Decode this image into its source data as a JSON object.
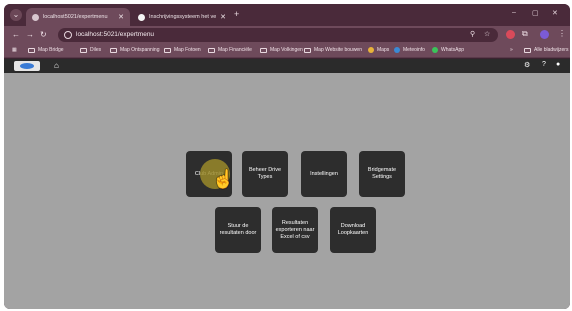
{
  "browser": {
    "tabs": [
      {
        "title": "localhost5021/expertmenu",
        "active": true
      },
      {
        "title": "Inschrijvingssysteem het verplaats",
        "active": false
      }
    ],
    "new_tab": "+",
    "window_controls": {
      "minimize": "–",
      "maximize": "▢",
      "close": "✕"
    },
    "url": "localhost:5021/expertmenu",
    "bookmarks": [
      {
        "label": "Map Bridge",
        "icon": "folder-icon"
      },
      {
        "label": "Diles",
        "icon": "folder-icon"
      },
      {
        "label": "Map Ontspanning",
        "icon": "folder-icon"
      },
      {
        "label": "Map Fotoen",
        "icon": "folder-icon"
      },
      {
        "label": "Map Financiële",
        "icon": "folder-icon"
      },
      {
        "label": "Map Volkingen",
        "icon": "folder-icon"
      },
      {
        "label": "Map Website bouwen",
        "icon": "folder-icon"
      },
      {
        "label": "Maps",
        "icon": "maps-icon"
      },
      {
        "label": "Meteoinfo",
        "icon": "weather-icon"
      },
      {
        "label": "WhatsApp",
        "icon": "whatsapp-icon"
      },
      {
        "label": "Alle bladwijzers",
        "icon": "folder-icon"
      }
    ]
  },
  "app": {
    "help": "?"
  },
  "tiles": [
    {
      "label": "Club Admin"
    },
    {
      "label": "Beheer Drive Types"
    },
    {
      "label": "Instellingen"
    },
    {
      "label": "Bridgemate Settings"
    },
    {
      "label": "Stuur de resultaten door"
    },
    {
      "label": "Resultaten exporteren naar Excel of csv"
    },
    {
      "label": "Download Loopkaarten"
    }
  ],
  "colors": {
    "browser_frame": "#4a2a3a",
    "toolbar": "#6e4a5b",
    "app_header": "#2b2b2b",
    "background": "#a3a3a3",
    "tile": "#2d2d2d",
    "tile_text": "#ffffff"
  }
}
